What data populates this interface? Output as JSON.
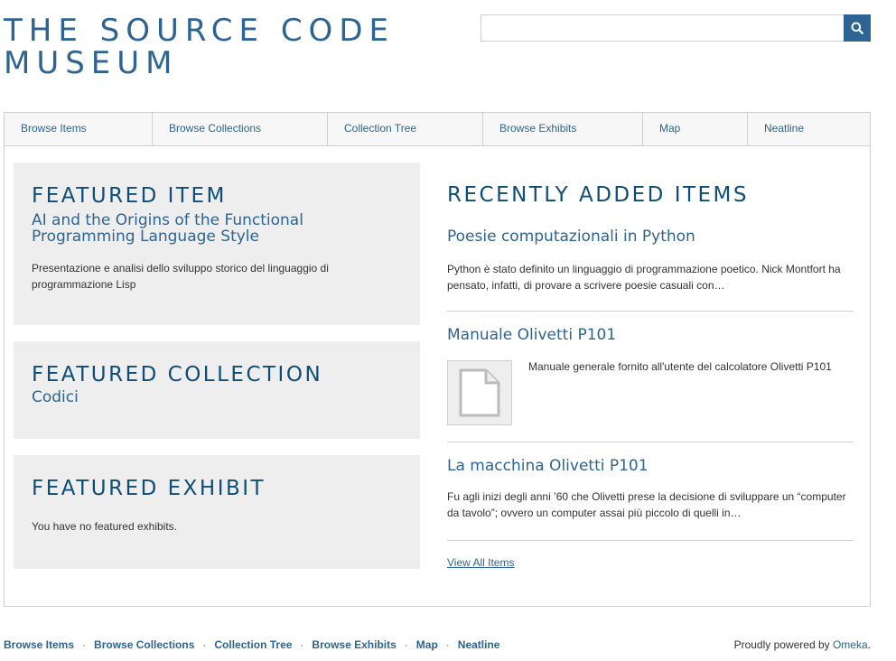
{
  "site": {
    "title": "The Source Code Museum"
  },
  "search": {
    "placeholder": "",
    "button_icon": "search-icon"
  },
  "nav": [
    "Browse Items",
    "Browse Collections",
    "Collection Tree",
    "Browse Exhibits",
    "Map",
    "Neatline"
  ],
  "featured_item": {
    "heading": "Featured Item",
    "title": "AI and the Origins of the Functional Programming Language Style",
    "description": "Presentazione e analisi dello sviluppo storico del linguaggio di programmazione Lisp"
  },
  "featured_collection": {
    "heading": "Featured Collection",
    "title": "Codici"
  },
  "featured_exhibit": {
    "heading": "Featured Exhibit",
    "message": "You have no featured exhibits."
  },
  "recent": {
    "heading": "Recently Added Items",
    "items": [
      {
        "title": "Poesie computazionali in Python",
        "description": "Python è stato definito un linguaggio di programmazione poetico. Nick Montfort ha pensato, infatti, di provare a scrivere poesie casuali con…"
      },
      {
        "title": "Manuale Olivetti P101",
        "description": "Manuale generale fornito all'utente del calcolatore Olivetti P101",
        "thumbnail_icon": "document-icon"
      },
      {
        "title": "La macchina Olivetti P101",
        "description": "Fu agli inizi degli anni ’60 che Olivetti prese la decisione di sviluppare un “computer da tavolo”; ovvero un computer assai più piccolo di quelli in…"
      }
    ],
    "view_all": "View All Items"
  },
  "footer": {
    "nav": [
      "Browse Items",
      "Browse Collections",
      "Collection Tree",
      "Browse Exhibits",
      "Map",
      "Neatline"
    ],
    "separator": "·",
    "powered_prefix": "Proudly powered by",
    "powered_link": "Omeka",
    "powered_suffix": "."
  },
  "colors": {
    "accent": "#2e6493",
    "heading": "#0e4d7a",
    "panel_bg": "#eeeeee",
    "border": "#cfcfcf"
  }
}
